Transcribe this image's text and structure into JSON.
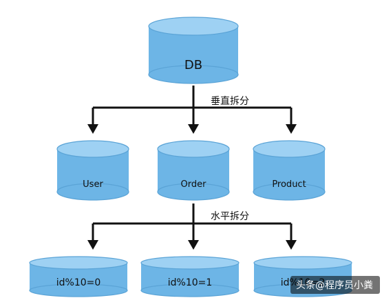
{
  "diagram": {
    "root_label": "DB",
    "vertical_split_label": "垂直拆分",
    "horizontal_split_label": "水平拆分",
    "mid_nodes": [
      "User",
      "Order",
      "Product"
    ],
    "bottom_nodes": [
      "id%10=0",
      "id%10=1",
      "id%10=2"
    ]
  },
  "watermark": "头条@程序员小粪",
  "colors": {
    "cylinder_fill": "#6db5e6",
    "cylinder_top": "#9ed1f3",
    "line": "#111111"
  }
}
